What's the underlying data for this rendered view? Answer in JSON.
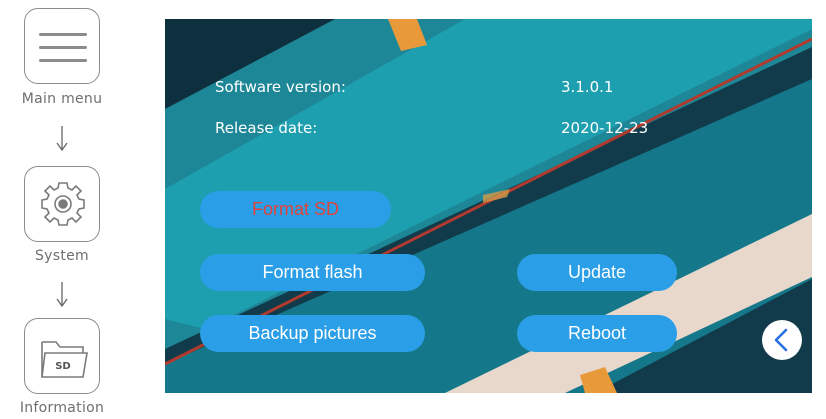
{
  "nav": {
    "items": [
      {
        "label": "Main menu",
        "icon": "hamburger-menu-icon"
      },
      {
        "label": "System",
        "icon": "gear-icon"
      },
      {
        "label": "Information",
        "icon": "sd-folder-icon",
        "icon_text": "SD"
      }
    ]
  },
  "screen": {
    "software_version_label": "Software version:",
    "software_version_value": "3.1.0.1",
    "release_date_label": "Release date:",
    "release_date_value": "2020-12-23",
    "buttons": {
      "format_sd": "Format SD",
      "format_flash": "Format flash",
      "backup_pictures": "Backup pictures",
      "update": "Update",
      "reboot": "Reboot"
    },
    "back_icon": "chevron-left-icon"
  },
  "colors": {
    "button_bg": "#2a9ee6",
    "active_text": "#e0443a",
    "background_dark": "#113a4a",
    "background_teal": "#1fa3b3"
  }
}
